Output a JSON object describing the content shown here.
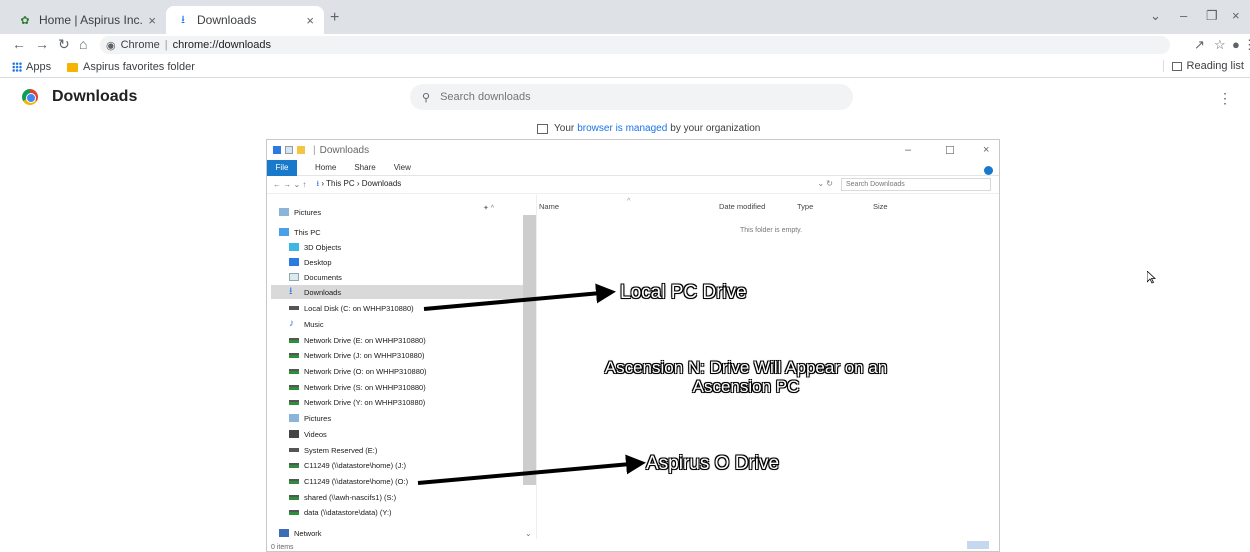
{
  "tabs": [
    {
      "title": "Home | Aspirus Inc., Wausa",
      "icon": "leaf-icon",
      "active": false
    },
    {
      "title": "Downloads",
      "icon": "download-icon",
      "active": true
    }
  ],
  "omnibox": {
    "site_label": "Chrome",
    "url": "chrome://downloads"
  },
  "bookmarks": {
    "apps": "Apps",
    "folder": "Aspirus favorites folder",
    "reading_list": "Reading list"
  },
  "downloads_page": {
    "title": "Downloads",
    "search_placeholder": "Search downloads",
    "managed_prefix": "Your",
    "managed_link": "browser is managed",
    "managed_suffix": "by your organization"
  },
  "explorer": {
    "window_title": "Downloads",
    "ribbon_tabs": [
      "File",
      "Home",
      "Share",
      "View"
    ],
    "path": [
      "This PC",
      "Downloads"
    ],
    "search_placeholder": "Search Downloads",
    "columns": [
      "Name",
      "Date modified",
      "Type",
      "Size"
    ],
    "empty_message": "This folder is empty.",
    "status": "0 items",
    "nav_items": [
      {
        "label": "Pictures",
        "icon": "pic"
      },
      {
        "label": "This PC",
        "icon": "pc"
      },
      {
        "label": "3D Objects",
        "icon": "obj"
      },
      {
        "label": "Desktop",
        "icon": "desk"
      },
      {
        "label": "Documents",
        "icon": "doc"
      },
      {
        "label": "Downloads",
        "icon": "dl",
        "selected": true
      },
      {
        "label": "Local Disk (C: on WHHP310880)",
        "icon": "drive"
      },
      {
        "label": "Music",
        "icon": "music"
      },
      {
        "label": "Network Drive (E: on WHHP310880)",
        "icon": "net"
      },
      {
        "label": "Network Drive (J: on WHHP310880)",
        "icon": "net"
      },
      {
        "label": "Network Drive (O: on WHHP310880)",
        "icon": "net"
      },
      {
        "label": "Network Drive (S: on WHHP310880)",
        "icon": "net"
      },
      {
        "label": "Network Drive (Y: on WHHP310880)",
        "icon": "net"
      },
      {
        "label": "Pictures",
        "icon": "pic"
      },
      {
        "label": "Videos",
        "icon": "vid"
      },
      {
        "label": "System Reserved (E:)",
        "icon": "drive"
      },
      {
        "label": "C11249 (\\\\datastore\\home) (J:)",
        "icon": "net"
      },
      {
        "label": "C11249 (\\\\datastore\\home) (O:)",
        "icon": "net"
      },
      {
        "label": "shared (\\\\awh-nascifs1) (S:)",
        "icon": "net"
      },
      {
        "label": "data (\\\\datastore\\data) (Y:)",
        "icon": "net"
      },
      {
        "label": "Network",
        "icon": "network"
      }
    ]
  },
  "annotations": {
    "local": "Local PC Drive",
    "ascension_line1": "Ascension N: Drive Will Appear on an",
    "ascension_line2": "Ascension PC",
    "aspirus": "Aspirus O Drive"
  }
}
